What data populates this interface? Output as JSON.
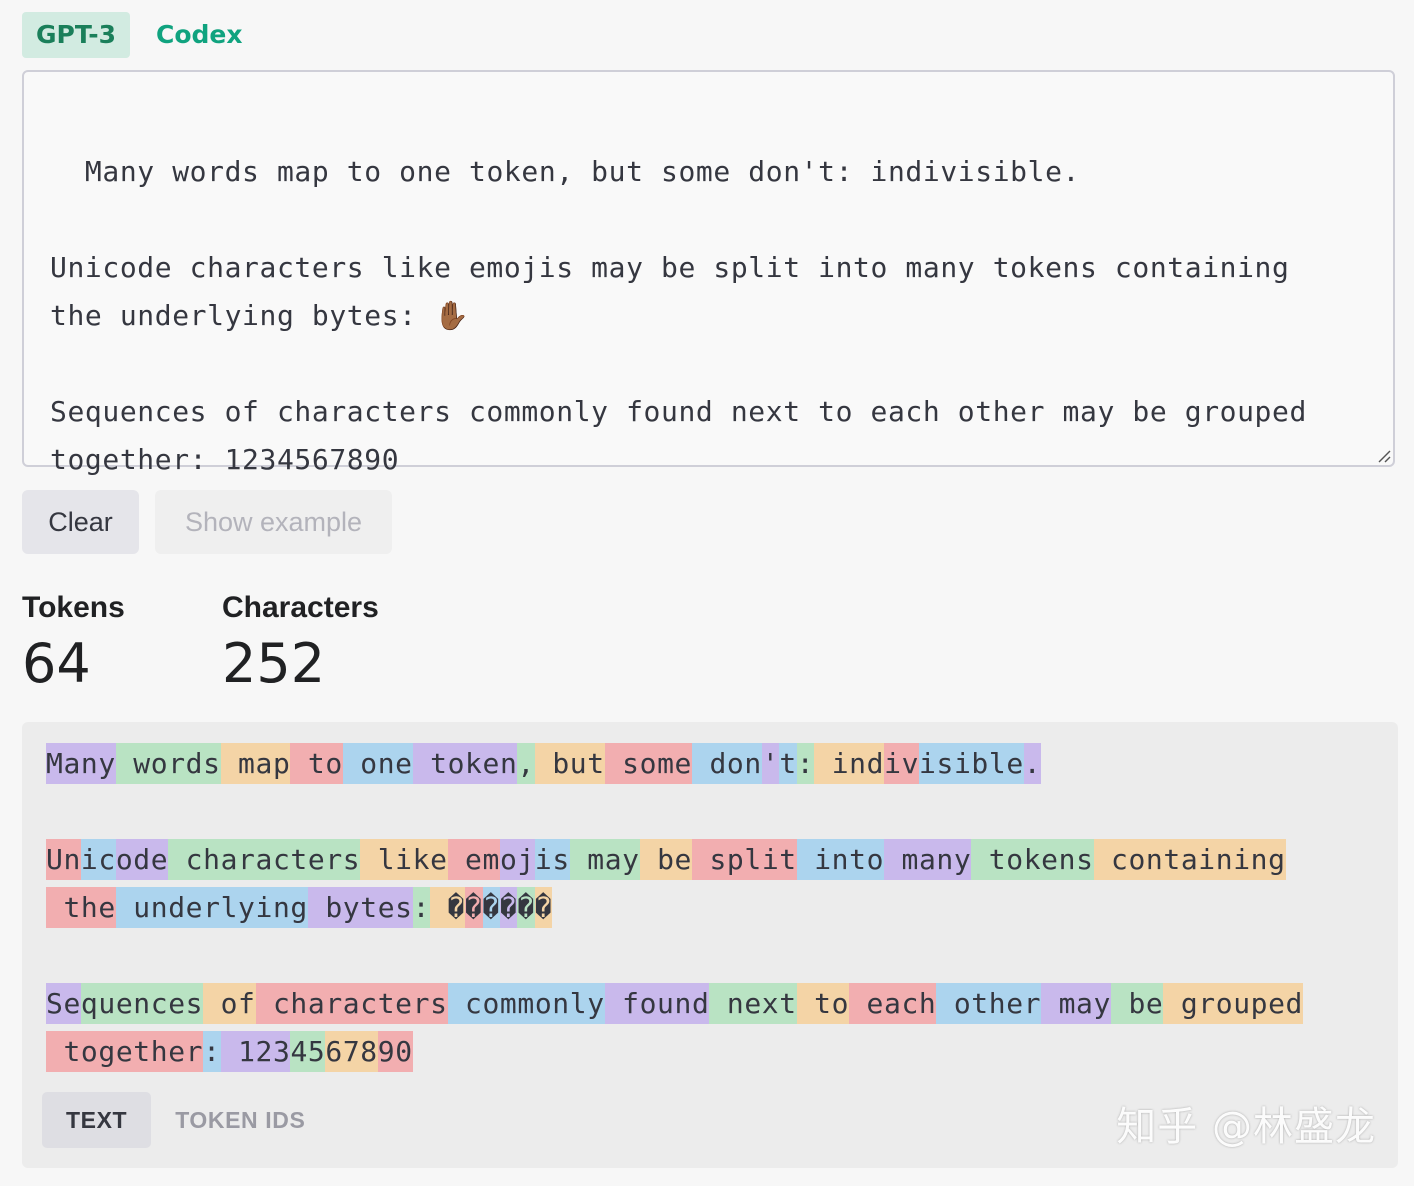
{
  "model_tabs": [
    {
      "label": "GPT-3",
      "active": true
    },
    {
      "label": "Codex",
      "active": false
    }
  ],
  "input": {
    "text": "Many words map to one token, but some don't: indivisible.\n\nUnicode characters like emojis may be split into many tokens containing\nthe underlying bytes: ✋🏾\n\nSequences of characters commonly found next to each other may be grouped\ntogether: 1234567890"
  },
  "buttons": {
    "clear": "Clear",
    "show_example": "Show example"
  },
  "stats": {
    "tokens_label": "Tokens",
    "tokens_value": "64",
    "characters_label": "Characters",
    "characters_value": "252"
  },
  "tokens": [
    [
      [
        "Many",
        0
      ],
      [
        " words",
        1
      ],
      [
        " map",
        2
      ],
      [
        " to",
        3
      ],
      [
        " one",
        4
      ],
      [
        " token",
        0
      ],
      [
        ",",
        1
      ],
      [
        " but",
        2
      ],
      [
        " some",
        3
      ],
      [
        " don",
        4
      ],
      [
        "'",
        0
      ],
      [
        "t",
        4
      ],
      [
        ":",
        1
      ],
      [
        " ind",
        2
      ],
      [
        "iv",
        3
      ],
      [
        "isible",
        4
      ],
      [
        ".",
        0
      ]
    ],
    [],
    [
      [
        "Un",
        3
      ],
      [
        "ic",
        4
      ],
      [
        "ode",
        0
      ],
      [
        " characters",
        1
      ],
      [
        " like",
        2
      ],
      [
        " em",
        3
      ],
      [
        "oj",
        0
      ],
      [
        "is",
        4
      ],
      [
        " may",
        1
      ],
      [
        " be",
        2
      ],
      [
        " split",
        3
      ],
      [
        " into",
        4
      ],
      [
        " many",
        0
      ],
      [
        " tokens",
        1
      ],
      [
        " containing",
        2
      ]
    ],
    [
      [
        " the",
        3
      ],
      [
        " underlying",
        4
      ],
      [
        " bytes",
        0
      ],
      [
        ":",
        1
      ],
      [
        " �",
        2
      ],
      [
        "�",
        3
      ],
      [
        "�",
        4
      ],
      [
        "�",
        0
      ],
      [
        "�",
        1
      ],
      [
        "�",
        2
      ]
    ],
    [],
    [
      [
        "Se",
        0
      ],
      [
        "quences",
        1
      ],
      [
        " of",
        2
      ],
      [
        " characters",
        3
      ],
      [
        " commonly",
        4
      ],
      [
        " found",
        0
      ],
      [
        " next",
        1
      ],
      [
        " to",
        2
      ],
      [
        " each",
        3
      ],
      [
        " other",
        4
      ],
      [
        " may",
        0
      ],
      [
        " be",
        1
      ],
      [
        " grouped",
        2
      ]
    ],
    [
      [
        " together",
        3
      ],
      [
        ":",
        4
      ],
      [
        " 123",
        0
      ],
      [
        "45",
        1
      ],
      [
        "678",
        2
      ],
      [
        "90",
        3
      ]
    ]
  ],
  "view_tabs": [
    {
      "label": "TEXT",
      "active": true
    },
    {
      "label": "TOKEN IDS",
      "active": false
    }
  ],
  "watermark": "知乎 @林盛龙"
}
